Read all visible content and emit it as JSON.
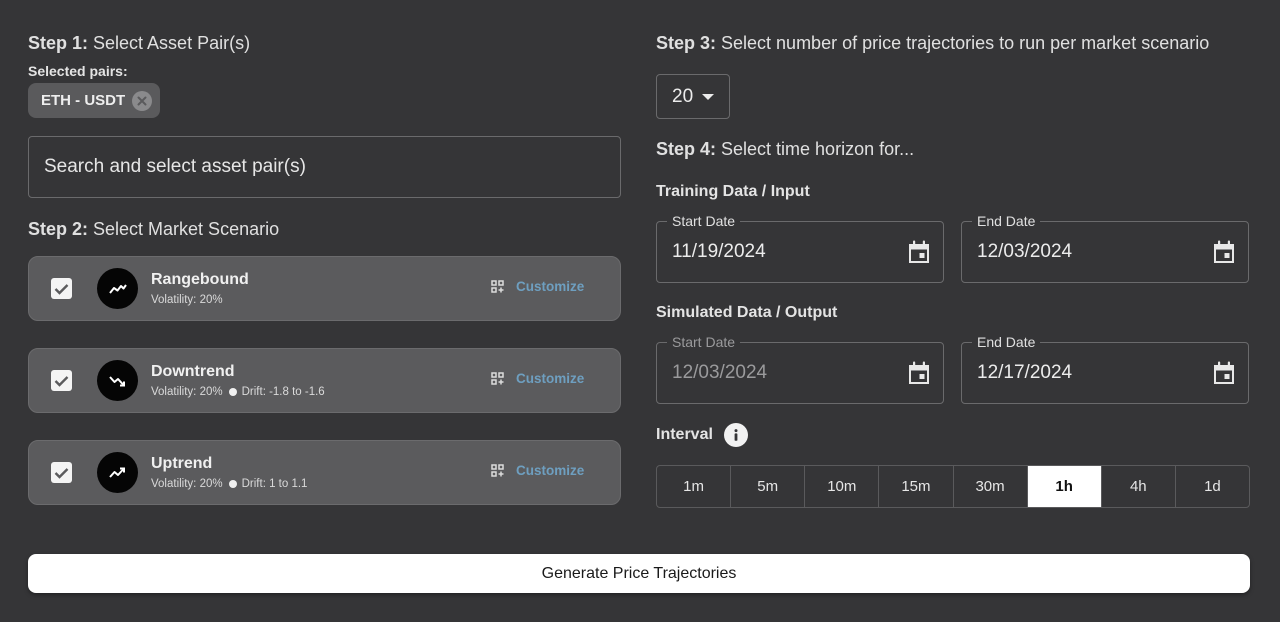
{
  "step1": {
    "prefix": "Step 1:",
    "text": " Select Asset Pair(s)",
    "selected_label": "Selected pairs:",
    "chip": "ETH - USDT",
    "search_placeholder": "Search and select asset pair(s)"
  },
  "step2": {
    "prefix": "Step 2:",
    "text": " Select Market Scenario",
    "scenarios": [
      {
        "name": "Rangebound",
        "volatility": "Volatility: 20%",
        "drift": "",
        "customize": "Customize",
        "checked": true,
        "icon": "rangebound-trend-icon"
      },
      {
        "name": "Downtrend",
        "volatility": "Volatility: 20%",
        "drift": "Drift: -1.8 to -1.6",
        "customize": "Customize",
        "checked": true,
        "icon": "downtrend-icon"
      },
      {
        "name": "Uptrend",
        "volatility": "Volatility: 20%",
        "drift": "Drift: 1 to 1.1",
        "customize": "Customize",
        "checked": true,
        "icon": "uptrend-icon"
      }
    ]
  },
  "step3": {
    "prefix": "Step 3:",
    "text": " Select number of price trajectories to run per market scenario",
    "value": "20"
  },
  "step4": {
    "prefix": "Step 4:",
    "text": " Select time horizon for...",
    "training": {
      "title": "Training Data / Input",
      "start_label": "Start Date",
      "start": "11/19/2024",
      "end_label": "End Date",
      "end": "12/03/2024"
    },
    "simulated": {
      "title": "Simulated Data / Output",
      "start_label": "Start Date",
      "start": "12/03/2024",
      "end_label": "End Date",
      "end": "12/17/2024"
    },
    "interval_label": "Interval",
    "intervals": [
      "1m",
      "5m",
      "10m",
      "15m",
      "30m",
      "1h",
      "4h",
      "1d"
    ],
    "selected_interval": "1h"
  },
  "generate_button": "Generate Price Trajectories",
  "colors": {
    "background": "#353537",
    "accent": "#6e9fc0",
    "card": "#5b5b5d"
  }
}
